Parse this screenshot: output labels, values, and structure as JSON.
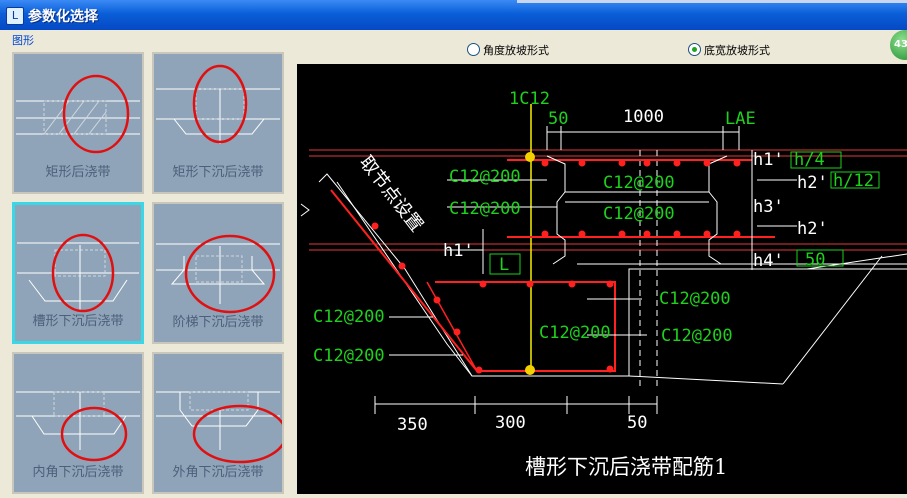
{
  "window": {
    "title": "参数化选择",
    "badge": "43"
  },
  "group": {
    "label": "图形"
  },
  "thumbnails": [
    {
      "caption": "矩形后浇带"
    },
    {
      "caption": "矩形下沉后浇带"
    },
    {
      "caption": "槽形下沉后浇带"
    },
    {
      "caption": "阶梯下沉后浇带"
    },
    {
      "caption": "内角下沉后浇带"
    },
    {
      "caption": "外角下沉后浇带"
    }
  ],
  "options": {
    "angle": "角度放坡形式",
    "width": "底宽放坡形式",
    "selected": "width"
  },
  "drawing": {
    "title": "槽形下沉后浇带配筋1",
    "labels": {
      "rebar_top": "1C12",
      "d50_top": "50",
      "d1000": "1000",
      "lae": "LAE",
      "h1p": "h1'",
      "h4frac": "h/4",
      "h2p": "h2'",
      "h12frac": "h/12",
      "h3p": "h3'",
      "h2p_b": "h2'",
      "h4p": "h4'",
      "v50": "50",
      "h1p_left": "h1'",
      "l": "L",
      "c1": "C12@200",
      "c2": "C12@200",
      "c3": "C12@200",
      "c4": "C12@200",
      "c5": "C12@200",
      "c6": "C12@200",
      "c7": "C12@200",
      "c8": "C12@200",
      "c9": "C12@200",
      "node_text": "取节点设置",
      "d350": "350",
      "d300": "300",
      "d50_bot": "50"
    }
  },
  "colors": {
    "accent": "#0a5fd8",
    "selection": "#3ad7e6",
    "annotation_circle": "#e01010",
    "cad_green": "#1dd11d",
    "cad_bg": "#000000"
  }
}
